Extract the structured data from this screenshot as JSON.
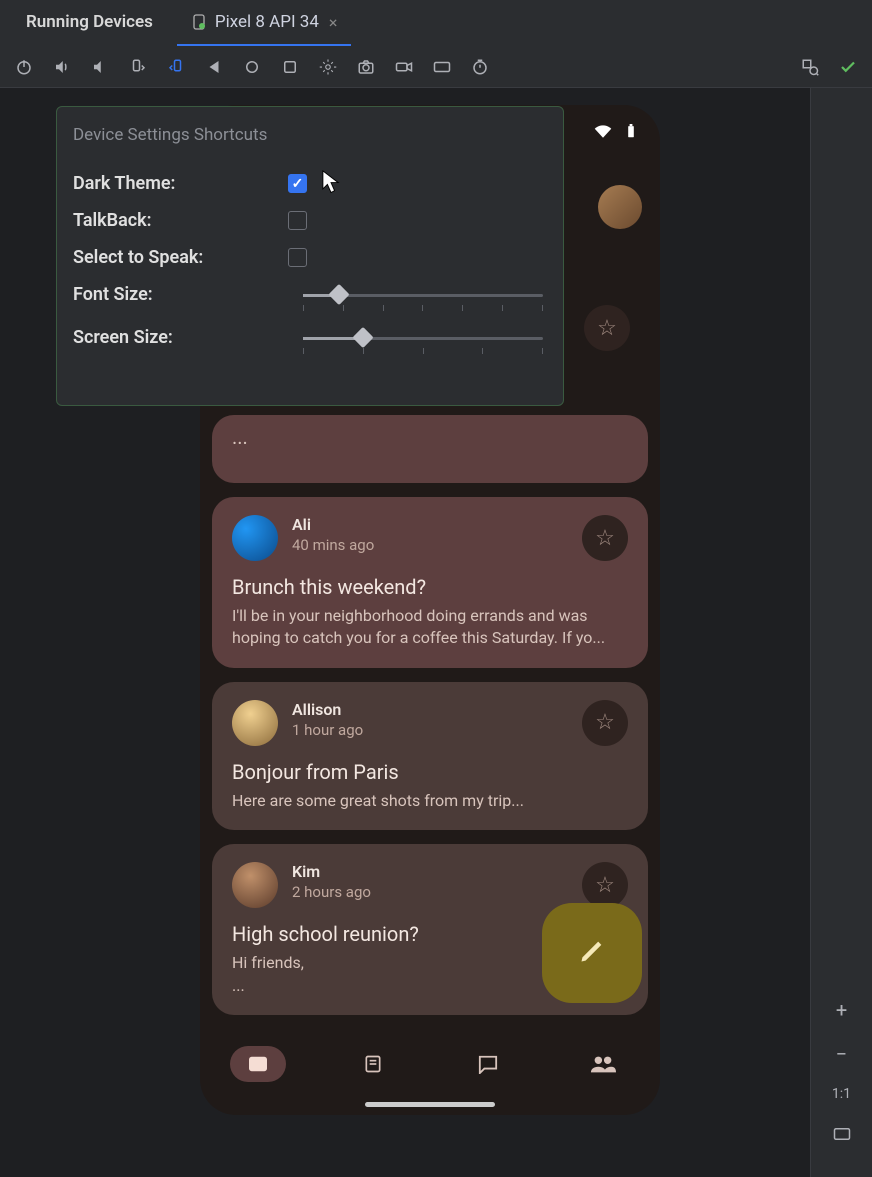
{
  "tabs": {
    "title": "Running Devices",
    "device": "Pixel 8 API 34"
  },
  "popup": {
    "title": "Device Settings Shortcuts",
    "dark_theme_label": "Dark Theme:",
    "dark_theme_checked": true,
    "talkback_label": "TalkBack:",
    "talkback_checked": false,
    "select_to_speak_label": "Select to Speak:",
    "select_to_speak_checked": false,
    "font_size_label": "Font Size:",
    "font_size_value": 1,
    "font_size_ticks": 7,
    "screen_size_label": "Screen Size:",
    "screen_size_value": 1,
    "screen_size_ticks": 5
  },
  "right_toolbar": {
    "zoom_label": "1:1"
  },
  "emails": [
    {
      "sender": "",
      "time": "",
      "subject": "",
      "preview": "...",
      "pinned": true,
      "truncated": true,
      "avatar_class": "av1"
    },
    {
      "sender": "Ali",
      "time": "40 mins ago",
      "subject": "Brunch this weekend?",
      "preview": "I'll be in your neighborhood doing errands and was hoping to catch you for a coffee this Saturday. If yo...",
      "pinned": true,
      "avatar_class": "av1"
    },
    {
      "sender": "Allison",
      "time": "1 hour ago",
      "subject": "Bonjour from Paris",
      "preview": "Here are some great shots from my trip...",
      "pinned": false,
      "avatar_class": "av2"
    },
    {
      "sender": "Kim",
      "time": "2 hours ago",
      "subject": "High school reunion?",
      "preview": "Hi friends,",
      "preview2": "...",
      "pinned": false,
      "avatar_class": "av3"
    }
  ]
}
